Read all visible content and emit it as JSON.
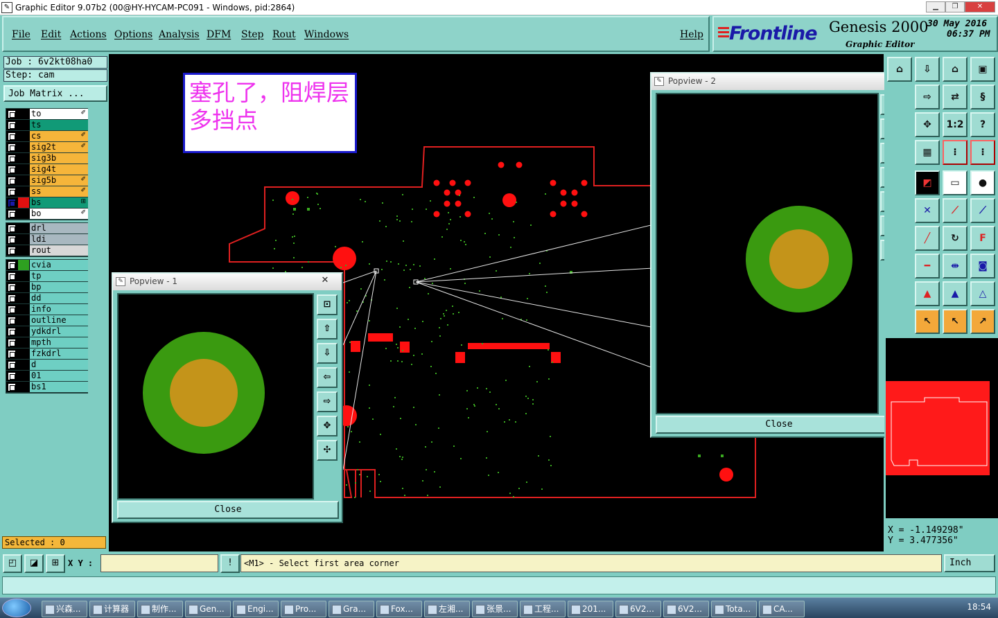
{
  "window": {
    "title": "Graphic Editor 9.07b2 (00@HY-HYCAM-PC091 - Windows, pid:2864)",
    "icon": "app-icon"
  },
  "menu": [
    "File",
    "Edit",
    "Actions",
    "Options",
    "Analysis",
    "DFM",
    "Step",
    "Rout",
    "Windows"
  ],
  "help": "Help",
  "brand": {
    "logo": "Frontline",
    "product": "Genesis 2000",
    "subtitle": "Graphic Editor",
    "date": "30 May 2016",
    "time": "06:37 PM"
  },
  "job": {
    "job": "Job : 6v2kt08ha0",
    "step": "Step: cam",
    "matrix_btn": "Job Matrix ..."
  },
  "layers_group1": [
    {
      "name": "to",
      "color": "#ffffff",
      "mark": "✐"
    },
    {
      "name": "ts",
      "color": "#119a77",
      "mark": ""
    },
    {
      "name": "cs",
      "color": "#f5b53a",
      "mark": "✐"
    },
    {
      "name": "sig2t",
      "color": "#f5b53a",
      "mark": "✐"
    },
    {
      "name": "sig3b",
      "color": "#f5b53a",
      "mark": ""
    },
    {
      "name": "sig4t",
      "color": "#f5b53a",
      "mark": ""
    },
    {
      "name": "sig5b",
      "color": "#f5b53a",
      "mark": "✐"
    },
    {
      "name": "ss",
      "color": "#f5b53a",
      "mark": "✐"
    },
    {
      "name": "bs",
      "color": "#119a77",
      "mark": "⊞",
      "active": true
    },
    {
      "name": "bo",
      "color": "#ffffff",
      "mark": "✐"
    }
  ],
  "layers_group2": [
    {
      "name": "drl",
      "color": "#a8b8c0"
    },
    {
      "name": "ldi",
      "color": "#a8b8c0"
    },
    {
      "name": "rout",
      "color": "#d8d8d8"
    }
  ],
  "layers_group3": [
    {
      "name": "cvia",
      "color": "#6ecfc3",
      "swatch": "#2ea020"
    },
    {
      "name": "tp",
      "color": "#6ecfc3"
    },
    {
      "name": "bp",
      "color": "#6ecfc3"
    },
    {
      "name": "dd",
      "color": "#6ecfc3"
    },
    {
      "name": "info",
      "color": "#6ecfc3"
    },
    {
      "name": "outline",
      "color": "#6ecfc3"
    },
    {
      "name": "ydkdrl",
      "color": "#6ecfc3"
    },
    {
      "name": "mpth",
      "color": "#6ecfc3"
    },
    {
      "name": "fzkdrl",
      "color": "#6ecfc3"
    },
    {
      "name": "d",
      "color": "#6ecfc3"
    },
    {
      "name": "01",
      "color": "#6ecfc3"
    },
    {
      "name": "bs1",
      "color": "#6ecfc3"
    }
  ],
  "selected": "Selected : 0",
  "note": "塞孔了，阻焊层多挡点",
  "popview1": {
    "title": "Popview - 1",
    "close": "Close"
  },
  "popview2": {
    "title": "Popview - 2",
    "close": "Close"
  },
  "coords": {
    "x": "X = -1.149298\"",
    "y": "Y = 3.477356\""
  },
  "status": {
    "xy_label": "X Y :",
    "message": "<M1> - Select first area corner",
    "unit": "Inch"
  },
  "colors": {
    "outline": "#e02020",
    "pad_outer": "#3a9a10",
    "pad_inner": "#c4941a",
    "via": "#3aaa20"
  },
  "taskbar": [
    {
      "label": "兴森..."
    },
    {
      "label": "计算器"
    },
    {
      "label": "制作..."
    },
    {
      "label": "Gen..."
    },
    {
      "label": "Engi..."
    },
    {
      "label": "Pro..."
    },
    {
      "label": "Gra..."
    },
    {
      "label": "Fox..."
    },
    {
      "label": "左湘..."
    },
    {
      "label": "张景..."
    },
    {
      "label": "工程..."
    },
    {
      "label": "201..."
    },
    {
      "label": "6V2..."
    },
    {
      "label": "6V2..."
    },
    {
      "label": "Tota..."
    },
    {
      "label": "CA..."
    }
  ],
  "clock": "18:54"
}
